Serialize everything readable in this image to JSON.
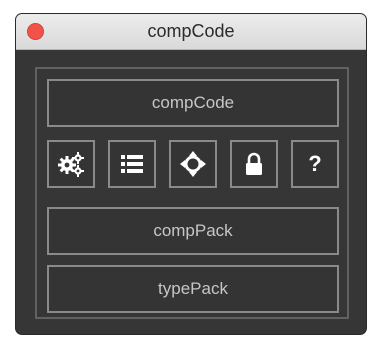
{
  "window": {
    "title": "compCode"
  },
  "buttons": {
    "compcode_label": "compCode",
    "comppack_label": "compPack",
    "typepack_label": "typePack"
  },
  "toolbar": {
    "icons": [
      "settings-gears-icon",
      "list-icon",
      "crosshair-move-icon",
      "lock-icon",
      "help-question-icon"
    ],
    "help_glyph": "?"
  },
  "colors": {
    "window_bg": "#363636",
    "button_border": "#8a8a8a",
    "button_text": "#c6c6c6",
    "close_button": "#f2524a"
  }
}
